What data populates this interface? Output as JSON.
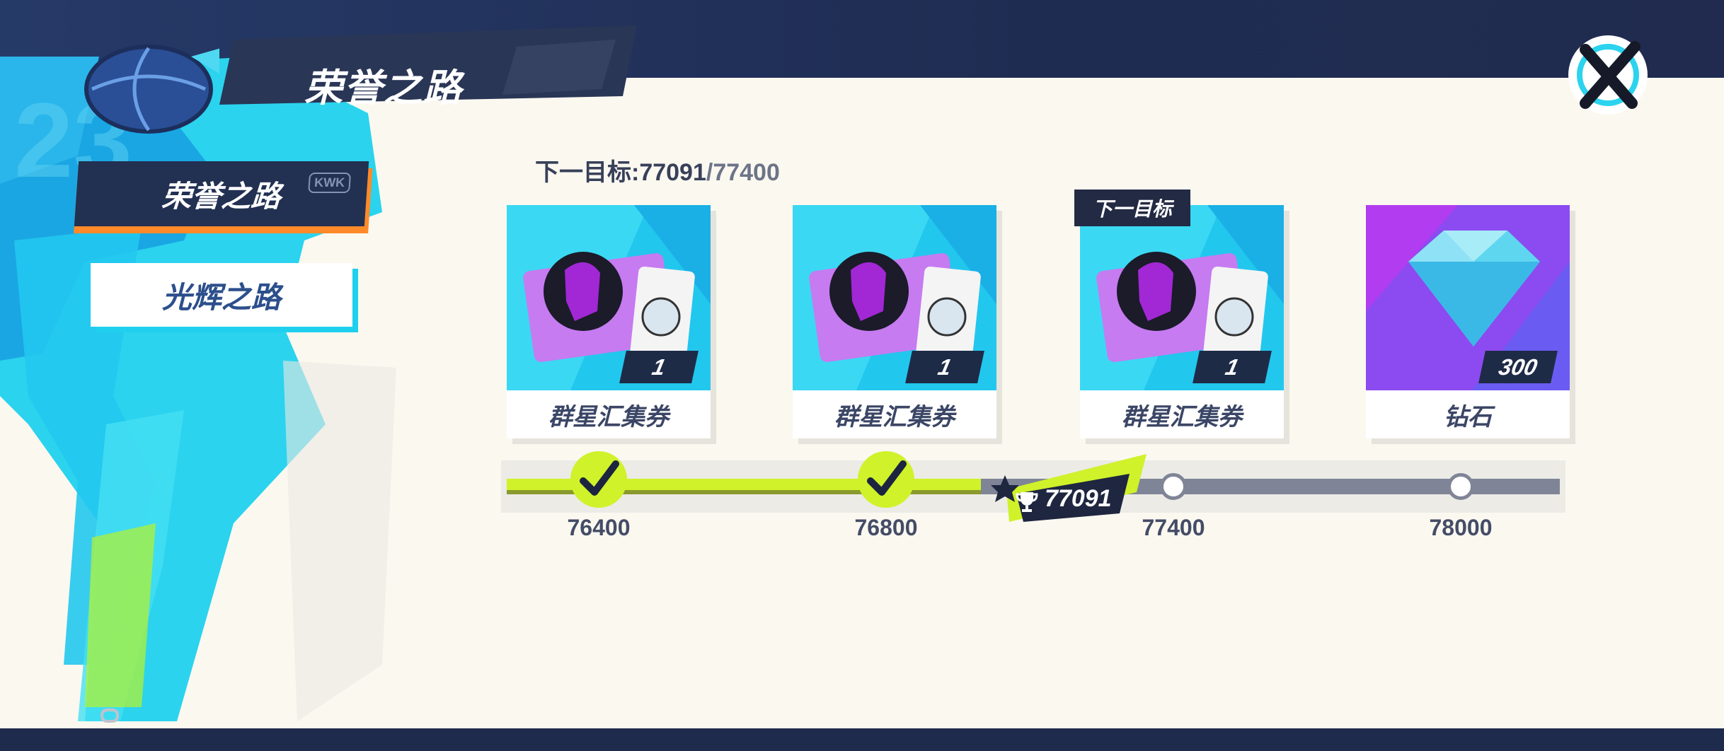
{
  "header": {
    "title": "荣誉之路"
  },
  "nav": {
    "items": [
      {
        "label": "荣誉之路",
        "tag": "KWK",
        "active": true
      },
      {
        "label": "光辉之路",
        "active": false
      }
    ]
  },
  "progress": {
    "next_target_label": "下一目标:",
    "current": "77091",
    "separator": "/",
    "target": "77400",
    "current_marker_value": "77091",
    "fill_fraction": 0.45,
    "milestones": [
      "76400",
      "76800",
      "77400",
      "78000"
    ],
    "milestone_states": [
      "completed",
      "completed",
      "pending",
      "pending"
    ]
  },
  "rewards": [
    {
      "name": "群星汇集券",
      "qty": "1",
      "icon": "star-gathering-ticket-icon"
    },
    {
      "name": "群星汇集券",
      "qty": "1",
      "icon": "star-gathering-ticket-icon"
    },
    {
      "name": "群星汇集券",
      "qty": "1",
      "icon": "star-gathering-ticket-icon",
      "next_tag": "下一目标"
    },
    {
      "name": "钻石",
      "qty": "300",
      "icon": "diamond-icon"
    }
  ],
  "icons": {
    "close": "close-icon",
    "check": "check-icon",
    "trophy": "trophy-icon",
    "basketball": "basketball-icon"
  },
  "colors": {
    "accent_lime": "#cff22a",
    "navy": "#223052",
    "cyan": "#1fd0ee",
    "orange": "#ff8a2a",
    "purple": "#b23cf0"
  }
}
